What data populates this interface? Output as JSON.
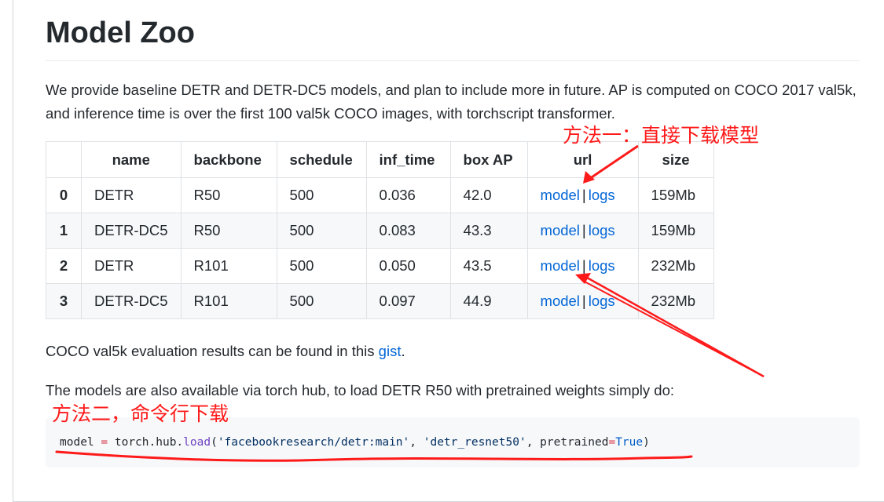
{
  "page": {
    "title": "Model Zoo",
    "intro": "We provide baseline DETR and DETR-DC5 models, and plan to include more in future. AP is computed on COCO 2017 val5k, and inference time is over the first 100 val5k COCO images, with torchscript transformer.",
    "eval_text_before": "COCO val5k evaluation results can be found in this ",
    "eval_link": "gist",
    "eval_text_after": ".",
    "hub_text": "The models are also available via torch hub, to load DETR R50 with pretrained weights simply do:"
  },
  "table": {
    "headers": [
      "",
      "name",
      "backbone",
      "schedule",
      "inf_time",
      "box AP",
      "url",
      "size"
    ],
    "rows": [
      {
        "idx": "0",
        "name": "DETR",
        "backbone": "R50",
        "schedule": "500",
        "inf_time": "0.036",
        "box_ap": "42.0",
        "model": "model",
        "logs": "logs",
        "size": "159Mb"
      },
      {
        "idx": "1",
        "name": "DETR-DC5",
        "backbone": "R50",
        "schedule": "500",
        "inf_time": "0.083",
        "box_ap": "43.3",
        "model": "model",
        "logs": "logs",
        "size": "159Mb"
      },
      {
        "idx": "2",
        "name": "DETR",
        "backbone": "R101",
        "schedule": "500",
        "inf_time": "0.050",
        "box_ap": "43.5",
        "model": "model",
        "logs": "logs",
        "size": "232Mb"
      },
      {
        "idx": "3",
        "name": "DETR-DC5",
        "backbone": "R101",
        "schedule": "500",
        "inf_time": "0.097",
        "box_ap": "44.9",
        "model": "model",
        "logs": "logs",
        "size": "232Mb"
      }
    ],
    "separator": "|"
  },
  "code": {
    "var": "model",
    "eq": "=",
    "obj": "torch.hub.",
    "fn": "load",
    "open": "(",
    "arg1": "'facebookresearch/detr:main'",
    "comma1": ", ",
    "arg2": "'detr_resnet50'",
    "comma2": ", ",
    "kw": "pretrained",
    "eq2": "=",
    "val": "True",
    "close": ")"
  },
  "annotations": {
    "method1": "方法一：直接下载模型",
    "method2": "方法二，命令行下载",
    "color": "#ff1a1a"
  },
  "colors": {
    "link": "#0366d6",
    "text": "#24292e",
    "stripe": "#f6f8fa",
    "border": "#dfe2e5"
  }
}
